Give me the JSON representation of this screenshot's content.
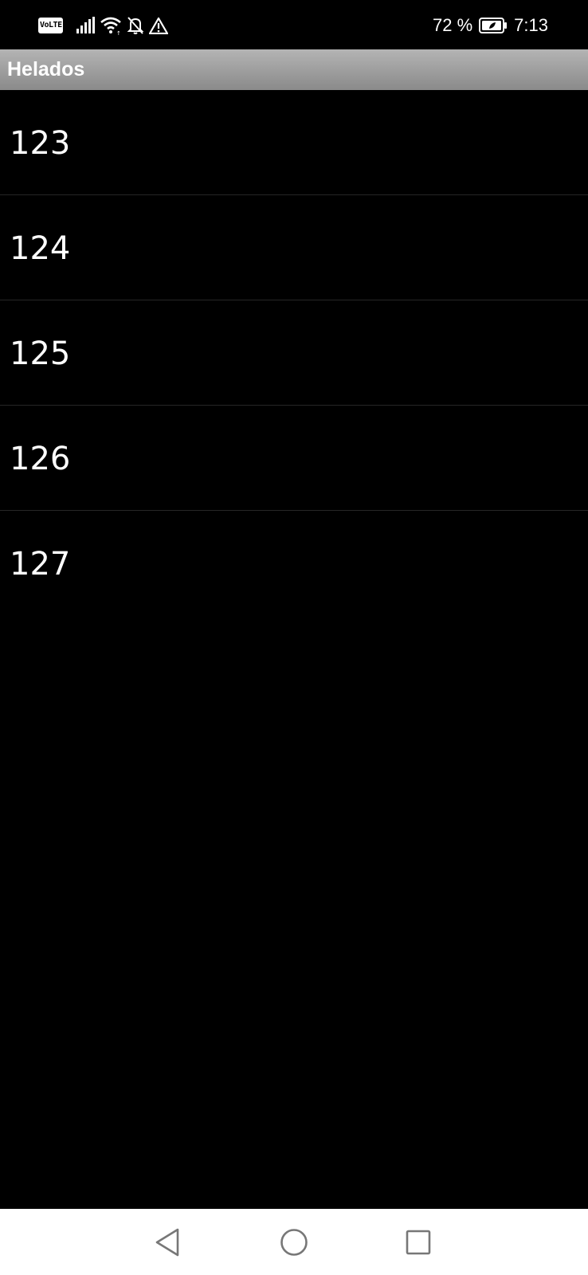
{
  "status_bar": {
    "volte_label": "VoLTE",
    "battery_percent": "72 %",
    "time": "7:13",
    "icons": [
      "volte-icon",
      "signal-icon",
      "wifi-icon",
      "bell-off-icon",
      "warning-icon",
      "battery-icon"
    ]
  },
  "action_bar": {
    "title": "Helados"
  },
  "list": {
    "items": [
      {
        "label": "123"
      },
      {
        "label": "124"
      },
      {
        "label": "125"
      },
      {
        "label": "126"
      },
      {
        "label": "127"
      }
    ]
  },
  "nav_bar": {
    "icons": [
      "back-icon",
      "home-icon",
      "recents-icon"
    ]
  },
  "colors": {
    "background": "#000000",
    "action_bar_top": "#b4b4b4",
    "action_bar_bottom": "#8a8a8a",
    "text": "#ffffff",
    "divider": "#262626",
    "nav_bar": "#ffffff",
    "nav_icon": "#777777"
  }
}
